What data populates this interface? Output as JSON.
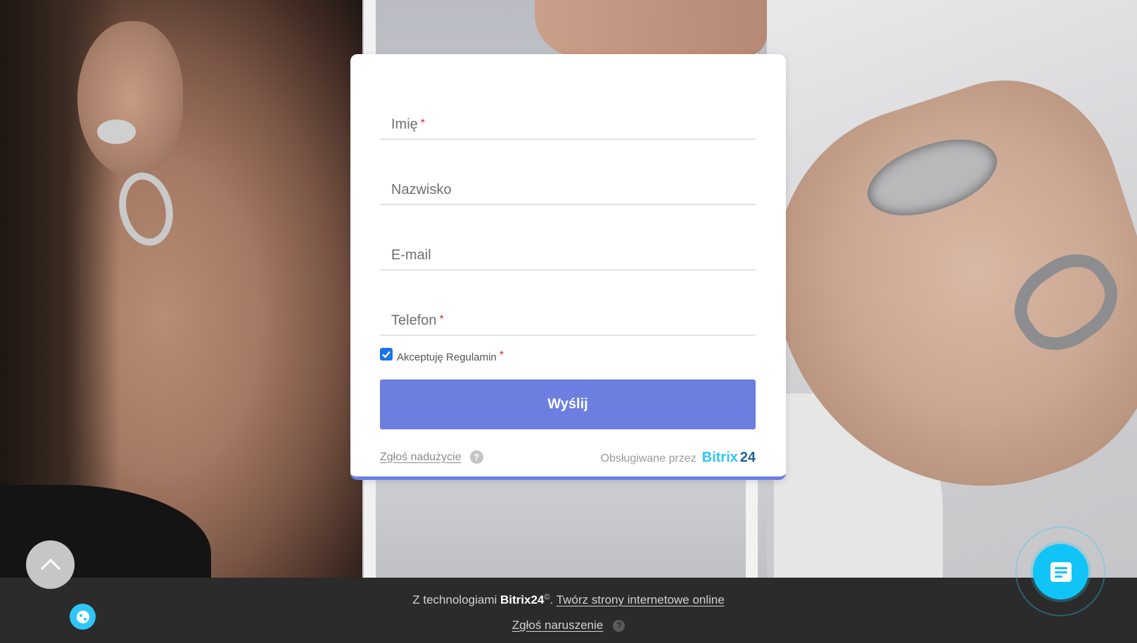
{
  "form": {
    "fields": [
      {
        "label": "Imię",
        "required_mark": "*"
      },
      {
        "label": "Nazwisko",
        "required_mark": ""
      },
      {
        "label": "E-mail",
        "required_mark": ""
      },
      {
        "label": "Telefon",
        "required_mark": "*"
      }
    ],
    "consent": {
      "label": "Akceptuję Regulamin",
      "required_mark": "*",
      "checked": true
    },
    "submit_label": "Wyślij",
    "abuse_link": "Zgłoś nadużycie",
    "help_glyph": "?",
    "powered_by": "Obsługiwane przez",
    "brand_name": "Bitrix",
    "brand_number": "24",
    "accent_color": "#6c7fe0"
  },
  "floating": {
    "scroll_top_icon": "chevron-up-icon",
    "cookie_icon": "cookie-icon",
    "chat_icon": "chat-form-icon",
    "chat_color": "#11c4f7"
  },
  "footer": {
    "prefix": "Z technologiami",
    "brand": "Bitrix24",
    "brand_mark": "©",
    "separator": ".",
    "link": "Twórz strony internetowe online",
    "report": "Zgłoś naruszenie",
    "help_glyph": "?"
  }
}
